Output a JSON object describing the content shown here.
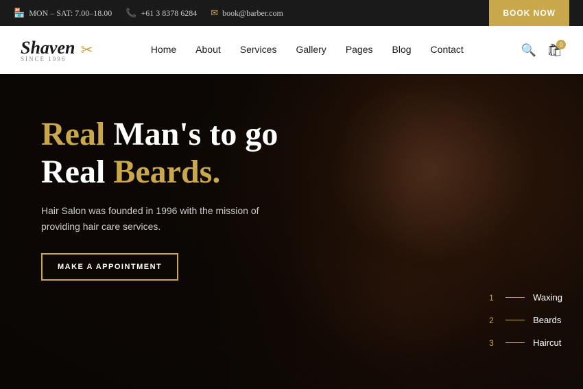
{
  "topbar": {
    "hours_icon": "🏪",
    "hours": "MON – SAT: 7.00–18.00",
    "phone_icon": "📞",
    "phone": "+61 3 8378 6284",
    "email_icon": "✉",
    "email": "book@barber.com",
    "book_now": "BOOK NOW"
  },
  "nav": {
    "logo_text": "Shaven",
    "logo_since": "SINCE 1996",
    "links": [
      {
        "label": "Home"
      },
      {
        "label": "About"
      },
      {
        "label": "Services"
      },
      {
        "label": "Gallery"
      },
      {
        "label": "Pages"
      },
      {
        "label": "Blog"
      },
      {
        "label": "Contact"
      }
    ],
    "cart_count": "0"
  },
  "hero": {
    "title_accent1": "Real",
    "title_white1": "Man's to go",
    "title_white2": "Real",
    "title_accent2": "Beards.",
    "description": "Hair Salon was founded in 1996 with the mission of providing hair care services.",
    "cta_button": "MAKE A APPOINTMENT",
    "side_items": [
      {
        "num": "1",
        "label": "Waxing"
      },
      {
        "num": "2",
        "label": "Beards"
      },
      {
        "num": "3",
        "label": "Haircut"
      }
    ]
  }
}
